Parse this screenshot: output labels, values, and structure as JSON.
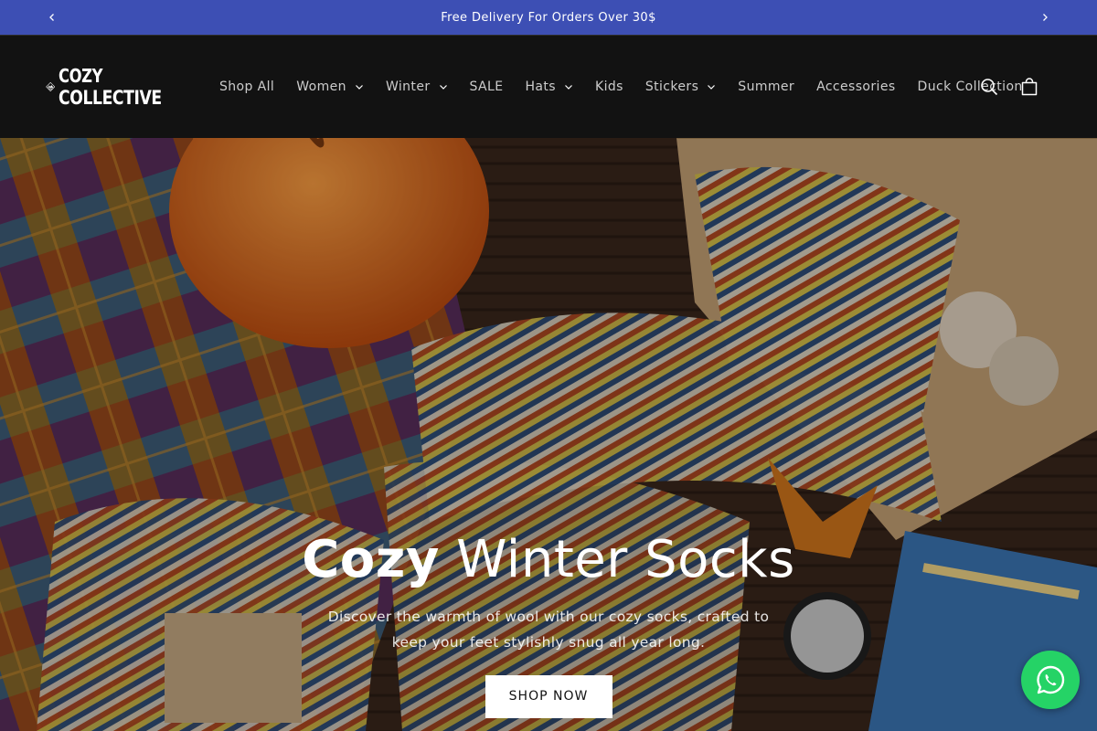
{
  "announcement": {
    "text": "Free Delivery For Orders Over 30$",
    "prev_icon": "chevron-left-icon",
    "next_icon": "chevron-right-icon"
  },
  "brand": {
    "logo_line1": "COZY",
    "logo_line2": "COLLECTIVE"
  },
  "nav": {
    "items": [
      {
        "label": "Shop All",
        "has_dropdown": false
      },
      {
        "label": "Women",
        "has_dropdown": true
      },
      {
        "label": "Winter",
        "has_dropdown": true
      },
      {
        "label": "SALE",
        "has_dropdown": false
      },
      {
        "label": "Hats",
        "has_dropdown": true
      },
      {
        "label": "Kids",
        "has_dropdown": false
      },
      {
        "label": "Stickers",
        "has_dropdown": true
      },
      {
        "label": "Summer",
        "has_dropdown": false
      },
      {
        "label": "Accessories",
        "has_dropdown": false
      },
      {
        "label": "Duck Collection",
        "has_dropdown": false
      }
    ]
  },
  "header_icons": {
    "search": "search-icon",
    "cart": "cart-icon"
  },
  "hero": {
    "title_bold": "Cozy",
    "title_rest": " Winter Socks",
    "subtitle": "Discover the warmth of wool with our cozy socks, crafted to keep your feet stylishly snug all year long.",
    "button_label": "SHOP NOW"
  },
  "chat": {
    "icon": "whatsapp-icon"
  },
  "colors": {
    "announcement_bg": "#3d4fb4",
    "header_bg": "#121212",
    "whatsapp": "#25d366"
  }
}
